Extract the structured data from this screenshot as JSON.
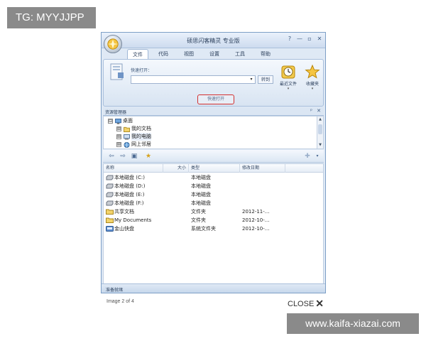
{
  "overlay": {
    "tg_badge": "TG: MYYJJPP",
    "url_banner": "www.kaifa-xiazai.com"
  },
  "window": {
    "title": "硕思闪客精灵 专业版",
    "controls": [
      "?",
      "—",
      "▫",
      "✕"
    ],
    "tabs": [
      "文件",
      "代码",
      "视图",
      "设置",
      "工具",
      "帮助"
    ],
    "active_tab": "文件"
  },
  "ribbon": {
    "quick_open_label": "快速打开：",
    "input_value": "",
    "go_button": "转到",
    "recent_files": "最近文件",
    "favorites": "收藏夹",
    "group_caption": "快速打开"
  },
  "explorer": {
    "title": "资源管理器",
    "pin": "ᵖ",
    "close": "✕",
    "tree": [
      {
        "label": "桌面",
        "expander": "⊟",
        "icon": "desktop-icon"
      },
      {
        "label": "我的文档",
        "expander": "⊞",
        "icon": "my-documents-icon"
      },
      {
        "label": "我的电脑",
        "expander": "⊞",
        "icon": "my-computer-icon"
      },
      {
        "label": "网上邻居",
        "expander": "⊞",
        "icon": "network-icon"
      }
    ]
  },
  "file_list": {
    "columns": [
      "名称",
      "大小",
      "类型",
      "修改日期"
    ],
    "rows": [
      {
        "name": "本地磁盘 (C:)",
        "size": "",
        "type": "本地磁盘",
        "modified": "",
        "icon": "drive-icon"
      },
      {
        "name": "本地磁盘 (D:)",
        "size": "",
        "type": "本地磁盘",
        "modified": "",
        "icon": "drive-icon"
      },
      {
        "name": "本地磁盘 (E:)",
        "size": "",
        "type": "本地磁盘",
        "modified": "",
        "icon": "drive-icon"
      },
      {
        "name": "本地磁盘 (F:)",
        "size": "",
        "type": "本地磁盘",
        "modified": "",
        "icon": "drive-icon"
      },
      {
        "name": "共享文档",
        "size": "",
        "type": "文件夹",
        "modified": "2012-11-...",
        "icon": "folder-icon"
      },
      {
        "name": "My Documents",
        "size": "",
        "type": "文件夹",
        "modified": "2012-10-...",
        "icon": "folder-icon"
      },
      {
        "name": "金山快盘",
        "size": "",
        "type": "系统文件夹",
        "modified": "2012-10-...",
        "icon": "cloud-drive-icon"
      }
    ]
  },
  "status": "准备就绪",
  "gallery": {
    "caption": "Image 2 of 4",
    "close_label": "CLOSE",
    "close_icon": "✕"
  },
  "colors": {
    "highlight_border": "#d32f2f",
    "window_border": "#7d9fc6",
    "banner_bg": "#8a8a8a"
  }
}
